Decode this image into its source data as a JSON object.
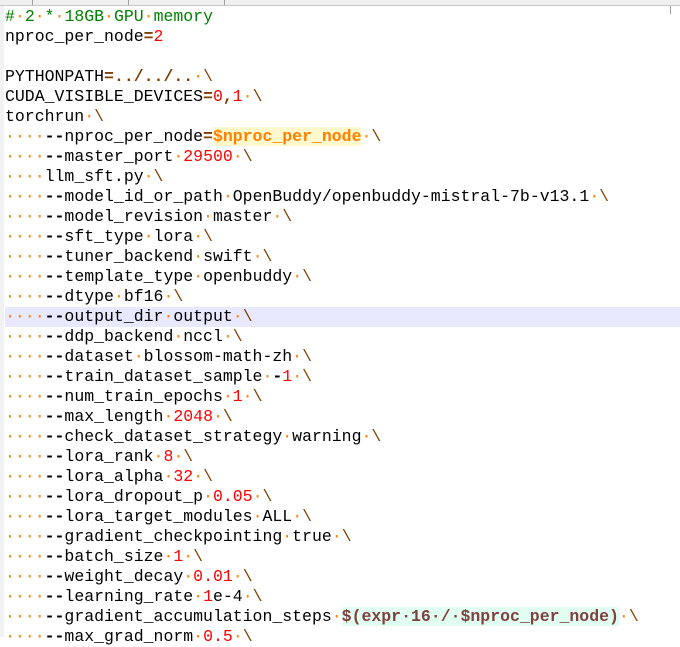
{
  "editor": {
    "current_line_index": 15,
    "lines": [
      "# 2 * 18GB GPU memory",
      "nproc_per_node=2",
      "",
      "PYTHONPATH=../../.. \\",
      "CUDA_VISIBLE_DEVICES=0,1 \\",
      "torchrun \\",
      "    --nproc_per_node=$nproc_per_node \\",
      "    --master_port 29500 \\",
      "    llm_sft.py \\",
      "    --model_id_or_path OpenBuddy/openbuddy-mistral-7b-v13.1 \\",
      "    --model_revision master \\",
      "    --sft_type lora \\",
      "    --tuner_backend swift \\",
      "    --template_type openbuddy \\",
      "    --dtype bf16 \\",
      "    --output_dir output \\",
      "    --ddp_backend nccl \\",
      "    --dataset blossom-math-zh \\",
      "    --train_dataset_sample -1 \\",
      "    --num_train_epochs 1 \\",
      "    --max_length 2048 \\",
      "    --check_dataset_strategy warning \\",
      "    --lora_rank 8 \\",
      "    --lora_alpha 32 \\",
      "    --lora_dropout_p 0.05 \\",
      "    --lora_target_modules ALL \\",
      "    --gradient_checkpointing true \\",
      "    --batch_size 1 \\",
      "    --weight_decay 0.01 \\",
      "    --learning_rate 1e-4 \\",
      "    --gradient_accumulation_steps $(expr 16 / $nproc_per_node) \\",
      "    --max_grad_norm 0.5 \\"
    ]
  },
  "colors": {
    "comment": "#008000",
    "number": "#ff0000",
    "operator": "#804000",
    "whitespace": "#ff8000",
    "current_line": "#e8e8ff"
  }
}
